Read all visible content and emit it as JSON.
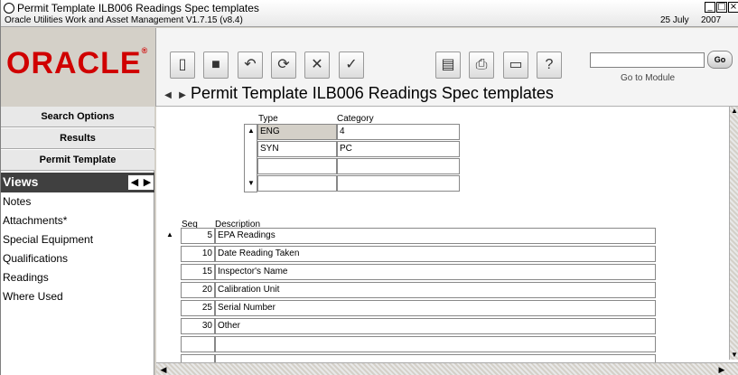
{
  "window": {
    "title": "Permit Template ILB006 Readings Spec templates",
    "subtitle": "Oracle Utilities Work and Asset Management V1.7.15 (v8.4)",
    "date_day": "25 July",
    "date_year": "2007"
  },
  "header": {
    "logo": "ORACLE",
    "page_title": "Permit Template ILB006 Readings Spec templates",
    "goto_label": "Go to Module",
    "go_button": "Go",
    "goto_value": ""
  },
  "toolbar": {
    "icons": [
      "new-icon",
      "save-icon",
      "undo-icon",
      "refresh-icon",
      "delete-icon",
      "spell-check-icon",
      "report-icon",
      "print-icon",
      "notes-icon",
      "help-icon"
    ]
  },
  "sidebar": {
    "buttons": [
      "Search Options",
      "Results",
      "Permit Template"
    ],
    "views_label": "Views",
    "items": [
      "Notes",
      "Attachments*",
      "Special Equipment",
      "Qualifications",
      "Readings",
      "Where Used"
    ]
  },
  "type_table": {
    "headers": [
      "Type",
      "Category"
    ],
    "rows": [
      {
        "type": "ENG",
        "category": "4"
      },
      {
        "type": "SYN",
        "category": "PC"
      },
      {
        "type": "",
        "category": ""
      },
      {
        "type": "",
        "category": ""
      }
    ]
  },
  "readings_table": {
    "headers": [
      "Seq",
      "Description"
    ],
    "rows": [
      {
        "seq": "5",
        "description": "EPA Readings"
      },
      {
        "seq": "10",
        "description": "Date Reading Taken"
      },
      {
        "seq": "15",
        "description": "Inspector's Name"
      },
      {
        "seq": "20",
        "description": "Calibration Unit"
      },
      {
        "seq": "25",
        "description": "Serial Number"
      },
      {
        "seq": "30",
        "description": "Other"
      },
      {
        "seq": "",
        "description": ""
      },
      {
        "seq": "",
        "description": ""
      }
    ]
  }
}
